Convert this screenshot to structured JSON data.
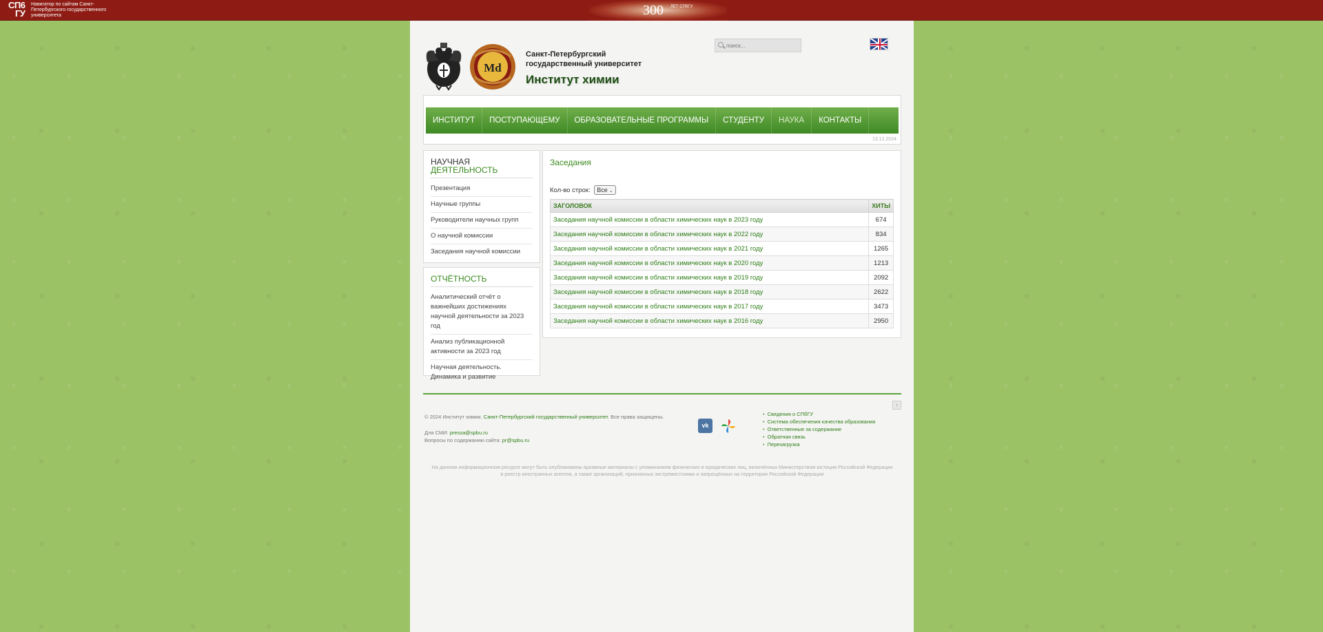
{
  "topbar": {
    "logo_line1": "СП6",
    "logo_line2": "ГУ",
    "nav_text": "Навигатор по сайтам Санкт-Петербургского государственного университета",
    "anniversary_number": "300",
    "anniversary_sub": "ЛЕТ СПбГУ"
  },
  "header": {
    "university_name": "Санкт-Петербургский государственный университет",
    "institute_name": "Институт химии",
    "medal_text": "Md",
    "search_placeholder": "поиск...",
    "language_flag": "uk-flag-icon"
  },
  "nav": {
    "items": [
      {
        "label": "ИНСТИТУТ"
      },
      {
        "label": "ПОСТУПАЮЩЕМУ"
      },
      {
        "label": "ОБРАЗОВАТЕЛЬНЫЕ ПРОГРАММЫ"
      },
      {
        "label": "СТУДЕНТУ"
      },
      {
        "label": "НАУКА"
      },
      {
        "label": "КОНТАКТЫ"
      }
    ],
    "date": "13.12.2024"
  },
  "sidebar": {
    "science": {
      "title_line1": "НАУЧНАЯ",
      "title_line2": "ДЕЯТЕЛЬНОСТЬ",
      "items": [
        {
          "label": "Презентация"
        },
        {
          "label": "Научные группы"
        },
        {
          "label": "Руководители научных групп"
        },
        {
          "label": "О научной комиссии"
        },
        {
          "label": "Заседания научной комиссии"
        }
      ]
    },
    "reports": {
      "title": "ОТЧЁТНОСТЬ",
      "items": [
        {
          "label": "Аналитический отчёт о важнейших достижениях научной деятельности за 2023 год"
        },
        {
          "label": "Анализ публикационной активности за 2023 год"
        },
        {
          "label": "Научная деятельность. Динамика и развитие"
        }
      ]
    }
  },
  "content": {
    "title": "Заседания",
    "rows_label": "Кол-во строк:",
    "rows_value": "Все",
    "table": {
      "headers": {
        "title": "ЗАГОЛОВОК",
        "hits": "ХИТЫ"
      },
      "rows": [
        {
          "title": "Заседания научной комиссии в области химических наук в 2023 году",
          "hits": "674"
        },
        {
          "title": "Заседания научной комиссии в области химических наук в 2022 году",
          "hits": "834"
        },
        {
          "title": "Заседания научной комиссии в области химических наук в 2021 году",
          "hits": "1265"
        },
        {
          "title": "Заседания научной комиссии в области химических наук в 2020 году",
          "hits": "1213"
        },
        {
          "title": "Заседания научной комиссии в области химических наук в 2019 году",
          "hits": "2092"
        },
        {
          "title": "Заседания научной комиссии в области химических наук в 2018 году",
          "hits": "2622"
        },
        {
          "title": "Заседания научной комиссии в области химических наук в 2017 году",
          "hits": "3473"
        },
        {
          "title": "Заседания научной комиссии в области химических наук в 2016 году",
          "hits": "2950"
        }
      ]
    }
  },
  "footer": {
    "copyright_prefix": "© 2024 Институт химии.",
    "copyright_link": "Санкт-Петербургский государственный университет",
    "copyright_suffix": "Все права защищены.",
    "media_label": "Для СМИ:",
    "media_email": "pressa@spbu.ru",
    "content_label": "Вопросы по содержанию сайта:",
    "content_email": "pr@spbu.ru",
    "vk_label": "vk",
    "links": [
      {
        "label": "Сведения о СПбГУ"
      },
      {
        "label": "Система обеспечения качества образования"
      },
      {
        "label": "Ответственные за содержание"
      },
      {
        "label": "Обратная связь"
      },
      {
        "label": "Перезагрузка"
      }
    ],
    "disclaimer": "На данном информационном ресурсе могут быть опубликованы архивные материалы с упоминанием физических и юридических лиц, включённых Министерством юстиции Российской Федерации в реестр иностранных агентов, а также организаций, признанных экстремистскими и запрещённых на территории Российской Федерации"
  },
  "colors": {
    "topbar": "#8e1c14",
    "nav_green": "#3f8a25",
    "link_green": "#2d7d16",
    "background": "#9cc266"
  }
}
